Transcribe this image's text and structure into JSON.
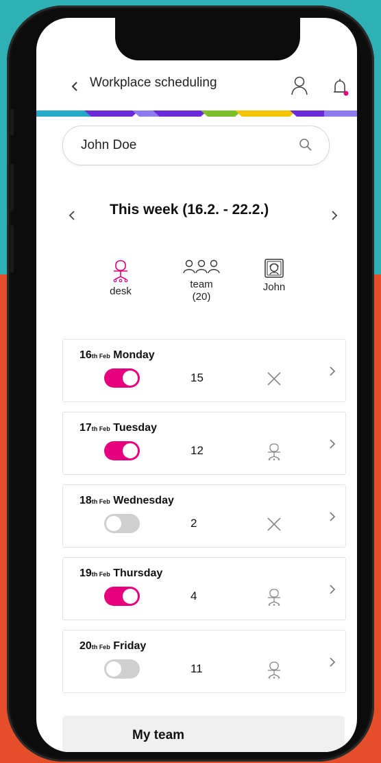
{
  "header": {
    "title": "Workplace scheduling",
    "back_icon": "chevron-left-icon",
    "user_icon": "user-icon",
    "bell_icon": "bell-icon",
    "notification_dot_color": "#e6007e"
  },
  "brand_stripe": [
    "#25a8c9",
    "#6c2bd9",
    "#8c7cf0",
    "#7dbf2a",
    "#f5c400",
    "#6c2bd9"
  ],
  "search": {
    "value": "John Doe",
    "icon": "search-icon"
  },
  "week": {
    "title": "This week (16.2. - 22.2.)",
    "prev_icon": "chevron-left-icon",
    "next_icon": "chevron-right-icon"
  },
  "filter_tabs": [
    {
      "label": "desk",
      "count": "",
      "icon": "desk-chair-icon",
      "active": true
    },
    {
      "label": "team",
      "count": "(20)",
      "icon": "team-icon",
      "active": false
    },
    {
      "label": "John",
      "count": "",
      "icon": "person-portrait-icon",
      "active": false
    }
  ],
  "days": [
    {
      "day": "16",
      "suffix": "th Feb",
      "weekday": "Monday",
      "toggle_on": true,
      "count": "15",
      "status_icon": "close-icon"
    },
    {
      "day": "17",
      "suffix": "th Feb",
      "weekday": "Tuesday",
      "toggle_on": true,
      "count": "12",
      "status_icon": "desk-chair-icon"
    },
    {
      "day": "18",
      "suffix": "th Feb",
      "weekday": "Wednesday",
      "toggle_on": false,
      "count": "2",
      "status_icon": "close-icon"
    },
    {
      "day": "19",
      "suffix": "th Feb",
      "weekday": "Thursday",
      "toggle_on": true,
      "count": "4",
      "status_icon": "desk-chair-icon"
    },
    {
      "day": "20",
      "suffix": "th Feb",
      "weekday": "Friday",
      "toggle_on": false,
      "count": "11",
      "status_icon": "desk-chair-icon"
    }
  ],
  "my_team": {
    "title": "My team"
  },
  "colors": {
    "accent": "#e6007e",
    "toggle_off": "#cfcfcf"
  }
}
